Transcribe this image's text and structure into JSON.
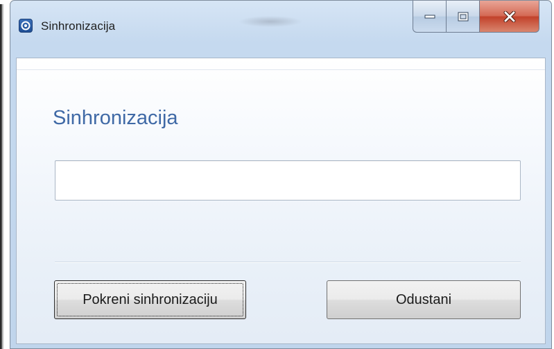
{
  "window": {
    "title": "Sinhronizacija",
    "app_icon": "app-logo-icon",
    "controls": {
      "minimize_icon": "minimize-icon",
      "maximize_icon": "maximize-icon",
      "close_icon": "close-icon"
    }
  },
  "dialog": {
    "heading": "Sinhronizacija",
    "input": {
      "value": "",
      "placeholder": ""
    },
    "buttons": {
      "start_label": "Pokreni sinhronizaciju",
      "cancel_label": "Odustani"
    }
  },
  "colors": {
    "heading": "#3f69a6",
    "close_button": "#c2422b",
    "titlebar": "#c5d9ef"
  }
}
